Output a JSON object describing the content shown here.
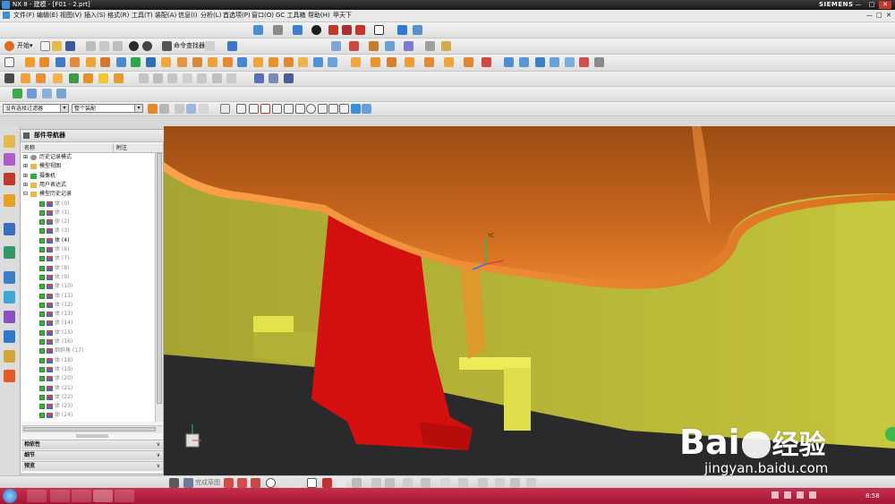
{
  "window": {
    "title": "NX 8 - 建模 - [F01 - 2.prt]",
    "brand": "SIEMENS",
    "controls": [
      "—",
      "□",
      "✕"
    ]
  },
  "menubar": {
    "items": [
      "文件(F)",
      "编辑(E)",
      "视图(V)",
      "插入(S)",
      "格式(R)",
      "工具(T)",
      "装配(A)",
      "信息(I)",
      "分析(L)",
      "首选项(P)",
      "窗口(O)",
      "GC 工具箱",
      "帮助(H)",
      "甲天下"
    ],
    "doc_controls": [
      "—",
      "□",
      "✕"
    ]
  },
  "toolbar_start": {
    "start_label": "开始▾",
    "command_finder_label": "命令查找器"
  },
  "selection_bar": {
    "filter_value": "没有选择过滤器",
    "scope_value": "整个装配"
  },
  "navigator": {
    "title": "部件导航器",
    "columns": [
      "名称",
      "附注"
    ],
    "tree": [
      {
        "label": "历史记录模式",
        "indent": 0,
        "kind": "clock"
      },
      {
        "label": "模型视图",
        "indent": 0,
        "kind": "folder"
      },
      {
        "label": "摄像机",
        "indent": 0,
        "kind": "camera"
      },
      {
        "label": "用户表达式",
        "indent": 0,
        "kind": "folder"
      },
      {
        "label": "模型历史记录",
        "indent": 0,
        "kind": "folder-open"
      },
      {
        "label": "体 (0)",
        "indent": 1,
        "kind": "feature"
      },
      {
        "label": "体 (1)",
        "indent": 1,
        "kind": "feature"
      },
      {
        "label": "体 (2)",
        "indent": 1,
        "kind": "feature"
      },
      {
        "label": "体 (3)",
        "indent": 1,
        "kind": "feature"
      },
      {
        "label": "体 (4)",
        "indent": 1,
        "kind": "feature",
        "highlight": true
      },
      {
        "label": "体 (6)",
        "indent": 1,
        "kind": "feature"
      },
      {
        "label": "体 (7)",
        "indent": 1,
        "kind": "feature"
      },
      {
        "label": "体 (8)",
        "indent": 1,
        "kind": "feature"
      },
      {
        "label": "体 (9)",
        "indent": 1,
        "kind": "feature"
      },
      {
        "label": "体 (10)",
        "indent": 1,
        "kind": "feature"
      },
      {
        "label": "体 (11)",
        "indent": 1,
        "kind": "feature"
      },
      {
        "label": "体 (12)",
        "indent": 1,
        "kind": "feature"
      },
      {
        "label": "体 (13)",
        "indent": 1,
        "kind": "feature"
      },
      {
        "label": "体 (14)",
        "indent": 1,
        "kind": "feature"
      },
      {
        "label": "体 (15)",
        "indent": 1,
        "kind": "feature"
      },
      {
        "label": "体 (16)",
        "indent": 1,
        "kind": "feature"
      },
      {
        "label": "倒斜角 (17)",
        "indent": 1,
        "kind": "feature"
      },
      {
        "label": "体 (18)",
        "indent": 1,
        "kind": "feature"
      },
      {
        "label": "体 (19)",
        "indent": 1,
        "kind": "feature"
      },
      {
        "label": "体 (20)",
        "indent": 1,
        "kind": "feature"
      },
      {
        "label": "体 (21)",
        "indent": 1,
        "kind": "feature"
      },
      {
        "label": "体 (22)",
        "indent": 1,
        "kind": "feature"
      },
      {
        "label": "体 (23)",
        "indent": 1,
        "kind": "feature"
      },
      {
        "label": "体 (24)",
        "indent": 1,
        "kind": "feature"
      }
    ],
    "panels": [
      "相依性",
      "细节",
      "预览"
    ]
  },
  "viewport": {
    "axis_label": "YC"
  },
  "bottombar": {
    "sketch_label": "完成草图"
  },
  "watermark": {
    "brand": "Bai",
    "brand_suffix": "经验",
    "url": "jingyan.baidu.com"
  },
  "taskbar": {
    "time": "8:58"
  },
  "colors": {
    "title_bg": "#1f1f1f",
    "viewport_bg": "#c0c03a",
    "orange_body": "#d9781f",
    "red_part": "#d40f0f",
    "taskbar": "#b82040"
  }
}
